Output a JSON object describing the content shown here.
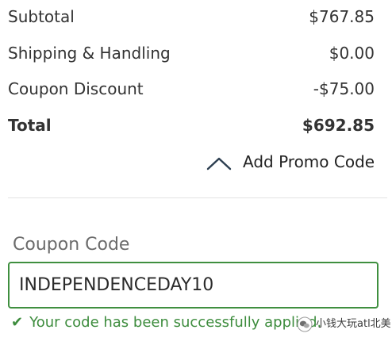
{
  "summary": {
    "subtotal": {
      "label": "Subtotal",
      "value": "$767.85"
    },
    "shipping": {
      "label": "Shipping & Handling",
      "value": "$0.00"
    },
    "coupon_discount": {
      "label": "Coupon Discount",
      "value": "-$75.00"
    },
    "total": {
      "label": "Total",
      "value": "$692.85"
    }
  },
  "promo": {
    "toggle_label": "Add Promo Code",
    "toggle_icon": "chevron-up-icon",
    "expanded": true
  },
  "coupon": {
    "label": "Coupon Code",
    "value": "INDEPENDENCEDAY10",
    "status_icon": "check-icon",
    "success_message": "Your code has been successfully applied."
  },
  "watermark": {
    "icon": "wechat-icon",
    "text": "小钱大玩atl北美"
  },
  "colors": {
    "success": "#3d8c3d",
    "input_border": "#3f8f3f",
    "chevron": "#2c3e50",
    "text": "#333333"
  }
}
